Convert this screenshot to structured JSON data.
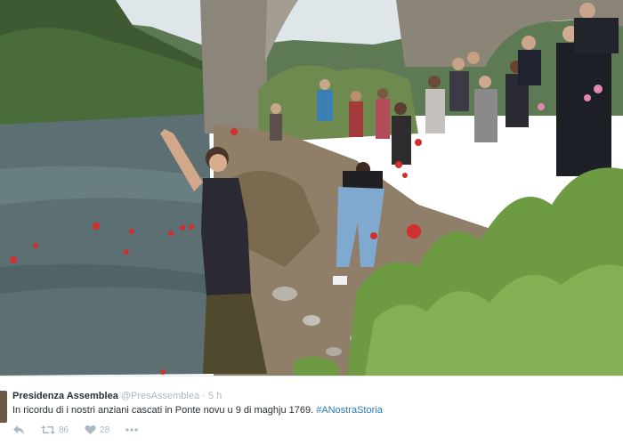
{
  "tweet": {
    "author_name": "Presidenza Assemblea",
    "handle": "@PresAssemblea",
    "separator": "·",
    "timestamp": "5 h",
    "text": "In ricordu di i nostri anziani cascati in Ponte novu u 9 di maghju 1769.",
    "hashtag": "#ANostraStoria",
    "retweet_count": "86",
    "like_count": "28"
  },
  "colors": {
    "name": "#292f33",
    "meta": "#aab8c2",
    "link": "#2b7bb9"
  },
  "icons": {
    "reply": "reply-icon",
    "retweet": "retweet-icon",
    "like": "heart-icon",
    "more": "more-icon"
  }
}
